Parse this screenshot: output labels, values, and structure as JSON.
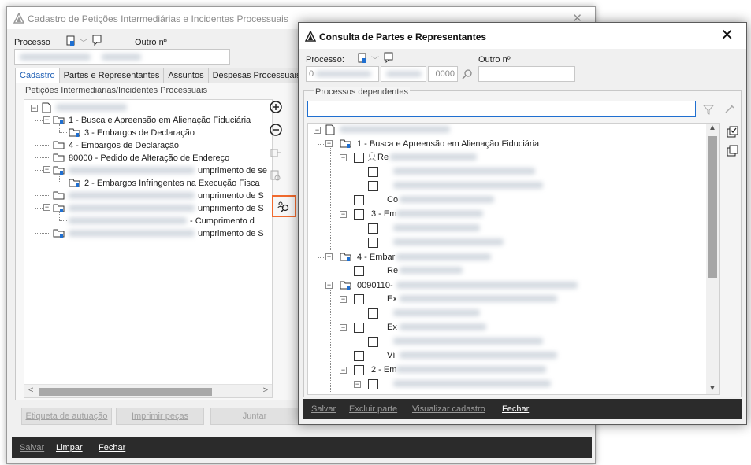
{
  "back_window": {
    "title": "Cadastro de Petições Intermediárias e Incidentes Processuais",
    "processo_label": "Processo",
    "outro_label": "Outro nº",
    "tabs": [
      "Cadastro",
      "Partes e Representantes",
      "Assuntos",
      "Despesas Processuais"
    ],
    "group_title": "Petições Intermediárias/Incidentes Processuais",
    "tree": [
      {
        "text": "1 - Busca e Apreensão em Alienação Fiduciária"
      },
      {
        "text": "3 - Embargos de Declaração"
      },
      {
        "text": "4 - Embargos de Declaração"
      },
      {
        "text": "80000 - Pedido de Alteração de Endereço"
      },
      {
        "text": "umprimento de se"
      },
      {
        "text": "2 - Embargos Infringentes na Execução Fisca"
      },
      {
        "text": "umprimento de S"
      },
      {
        "text": "umprimento de S"
      },
      {
        "text": "- Cumprimento d"
      },
      {
        "text": "umprimento de S"
      }
    ],
    "buttons": {
      "etiqueta": "Etiqueta de autuação",
      "imprimir": "Imprimir peças",
      "juntar": "Juntar"
    },
    "footer": {
      "salvar": "Salvar",
      "limpar": "Limpar",
      "fechar": "Fechar"
    }
  },
  "front_window": {
    "title": "Consulta de Partes e Representantes",
    "processo_label": "Processo:",
    "processo_prefix": "0",
    "processo_suffix": "0000",
    "outro_label": "Outro nº",
    "group_title": "Processos dependentes",
    "tree": [
      {
        "text": "1 - Busca e Apreensão em Alienação Fiduciária"
      },
      {
        "text": "Re"
      },
      {
        "text": "Co"
      },
      {
        "text": "3 - Em"
      },
      {
        "text": "4 - Embar"
      },
      {
        "text": "Re"
      },
      {
        "text": "0090110-"
      },
      {
        "text": "Ex"
      },
      {
        "text": "Ex"
      },
      {
        "text": "Ví"
      },
      {
        "text": "2 - Em"
      }
    ],
    "footer": {
      "salvar": "Salvar",
      "excluir": "Excluir parte",
      "visualizar": "Visualizar cadastro",
      "fechar": "Fechar"
    }
  },
  "colors": {
    "accent": "#1f6fd0",
    "highlight": "#f06a2e",
    "footer": "#2b2b2b"
  }
}
